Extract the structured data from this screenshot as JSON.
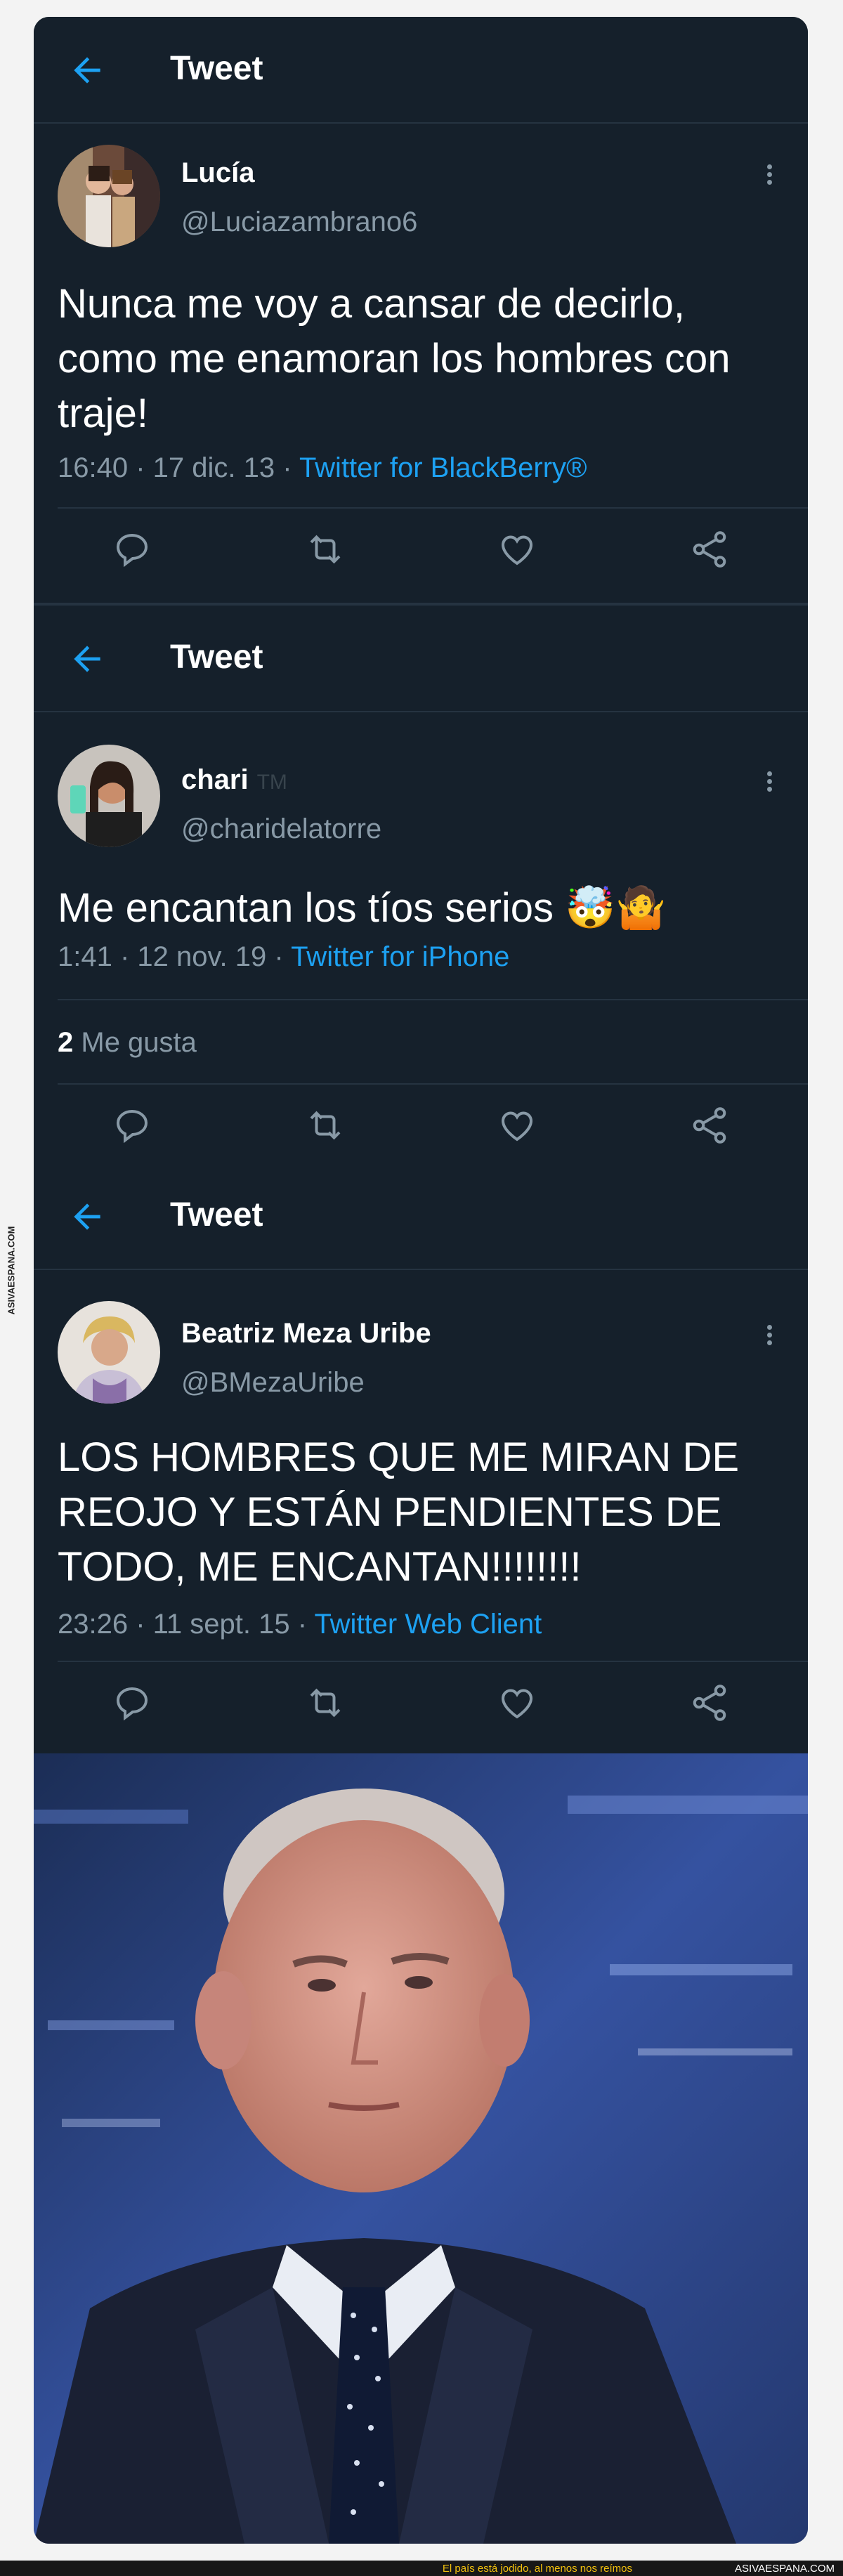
{
  "tweets": [
    {
      "header_title": "Tweet",
      "name": "Lucía",
      "handle": "@Luciazambrano6",
      "text": "Nunca me voy a cansar de decirlo, como me enamoran los hombres con traje!",
      "time": "16:40 · 17 dic. 13 · ",
      "source": "Twitter for BlackBerry®"
    },
    {
      "header_title": "Tweet",
      "name": "chari",
      "badge": "TM",
      "handle": "@charidelatorre",
      "text": "Me encantan los tíos serios 🤯🤷",
      "time": "1:41 · 12 nov. 19 · ",
      "source": "Twitter for iPhone",
      "likes_count": "2",
      "likes_label": "Me gusta"
    },
    {
      "header_title": "Tweet",
      "name": "Beatriz Meza Uribe",
      "handle": "@BMezaUribe",
      "text": "LOS HOMBRES QUE ME MIRAN DE REOJO Y ESTÁN PENDIENTES DE TODO, ME ENCANTAN!!!!!!!!",
      "time": "23:26 · 11 sept. 15 · ",
      "source": "Twitter Web Client"
    }
  ],
  "watermark": {
    "side": "ASIVAESPANA.COM",
    "footer_tagline": "El país está jodido, al menos nos reímos",
    "footer_site": "ASIVAESPANA.COM"
  },
  "colors": {
    "background": "#15202b",
    "accent": "#1da1f2",
    "secondary_text": "#8899a6",
    "divider": "#253341"
  },
  "icons": [
    "back-arrow-icon",
    "more-options-icon",
    "reply-icon",
    "retweet-icon",
    "like-icon",
    "share-icon"
  ]
}
